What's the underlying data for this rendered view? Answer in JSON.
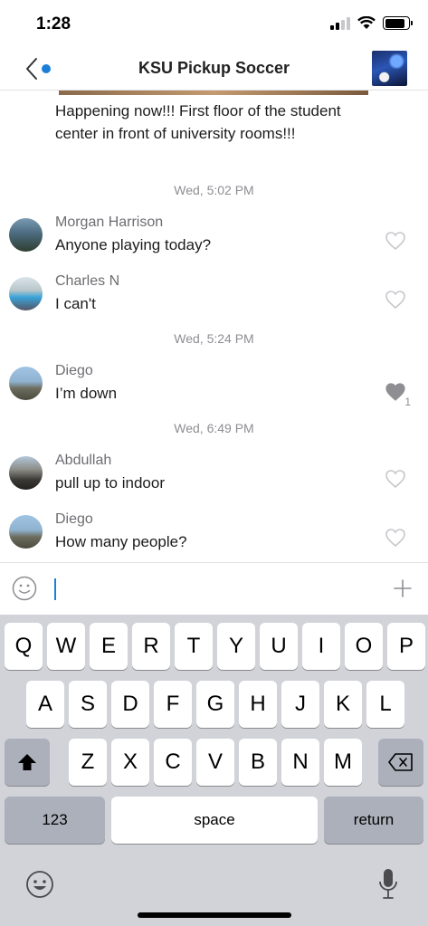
{
  "status_bar": {
    "time": "1:28",
    "icons": [
      "cellular-signal-icon",
      "wifi-icon",
      "battery-icon"
    ],
    "battery_level": 0.85
  },
  "header": {
    "title": "KSU Pickup Soccer",
    "back_icon": "chevron-left-icon",
    "unread_dot_color": "#1b7fd6"
  },
  "chat": {
    "continuation_text": "Happening now!!! First floor of the student center in front of university rooms!!!",
    "groups": [
      {
        "timestamp": "Wed, 5:02 PM",
        "messages": [
          {
            "sender": "Morgan Harrison",
            "text": "Anyone playing today?",
            "likes": "",
            "liked": false
          },
          {
            "sender": "Charles N",
            "text": "I can't",
            "likes": "",
            "liked": false
          }
        ]
      },
      {
        "timestamp": "Wed, 5:24 PM",
        "messages": [
          {
            "sender": "Diego",
            "text": "I’m down",
            "likes": "1",
            "liked": true
          }
        ]
      },
      {
        "timestamp": "Wed, 6:49 PM",
        "messages": [
          {
            "sender": "Abdullah",
            "text": "pull up to indoor",
            "likes": "",
            "liked": false
          },
          {
            "sender": "Diego",
            "text": "How many people?",
            "likes": "",
            "liked": false
          }
        ]
      }
    ]
  },
  "composer": {
    "value": "",
    "emoji_icon": "smiley-icon",
    "add_icon": "plus-icon"
  },
  "keyboard": {
    "row1": [
      "Q",
      "W",
      "E",
      "R",
      "T",
      "Y",
      "U",
      "I",
      "O",
      "P"
    ],
    "row2": [
      "A",
      "S",
      "D",
      "F",
      "G",
      "H",
      "J",
      "K",
      "L"
    ],
    "row3": [
      "Z",
      "X",
      "C",
      "V",
      "B",
      "N",
      "M"
    ],
    "numbers_label": "123",
    "space_label": "space",
    "return_label": "return"
  },
  "colors": {
    "accent": "#1b7fd6",
    "keyboard_bg": "#d1d3d9",
    "dark_key": "#abb0bb"
  }
}
